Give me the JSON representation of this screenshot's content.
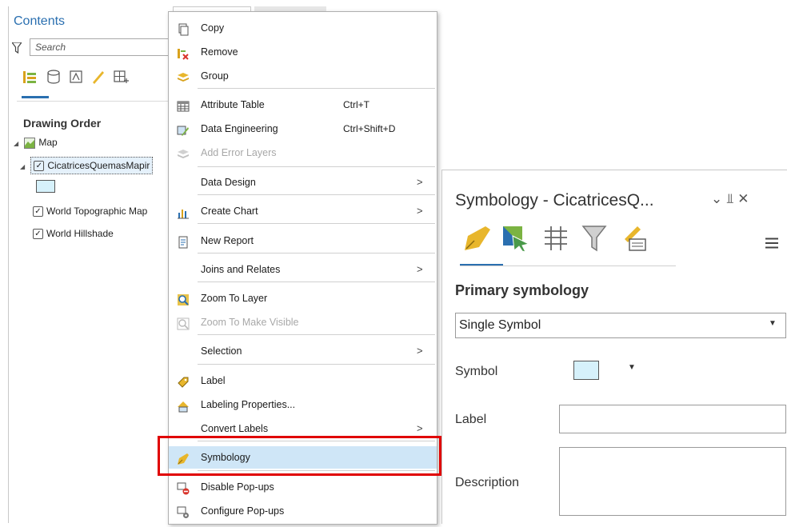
{
  "contents": {
    "title": "Contents",
    "search_placeholder": "Search",
    "section": "Drawing Order",
    "tree": {
      "map": "Map",
      "layer": "CicatricesQuemasMapir",
      "topo": "World Topographic Map",
      "hillshade": "World Hillshade"
    },
    "swatch_color": "#d6f1fb"
  },
  "menu": {
    "copy": "Copy",
    "remove": "Remove",
    "group": "Group",
    "attribute_table": "Attribute Table",
    "attribute_table_sc": "Ctrl+T",
    "data_engineering": "Data Engineering",
    "data_engineering_sc": "Ctrl+Shift+D",
    "add_error_layers": "Add Error Layers",
    "data_design": "Data Design",
    "create_chart": "Create Chart",
    "new_report": "New Report",
    "joins_relates": "Joins and Relates",
    "zoom_layer": "Zoom To Layer",
    "zoom_visible": "Zoom To Make Visible",
    "selection": "Selection",
    "label": "Label",
    "labeling_props": "Labeling Properties...",
    "convert_labels": "Convert Labels",
    "symbology": "Symbology",
    "disable_popups": "Disable Pop-ups",
    "configure_popups": "Configure Pop-ups",
    "submenu_arrow": ">"
  },
  "symbology": {
    "title": "Symbology - CicatricesQ...",
    "controls": "⌄  ⫫  ✕",
    "primary": "Primary symbology",
    "method": "Single Symbol",
    "symbol_label": "Symbol",
    "label_label": "Label",
    "description_label": "Description",
    "label_value": "",
    "description_value": ""
  },
  "colors": {
    "accent": "#2a6fb0",
    "highlight": "#cfe6f7",
    "callout": "#e00000"
  }
}
